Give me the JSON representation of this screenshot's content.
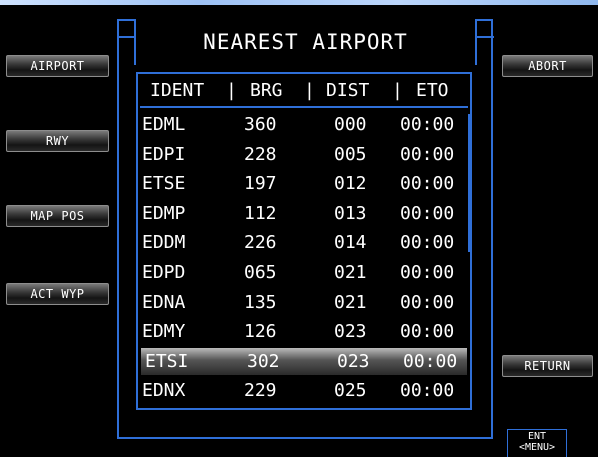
{
  "window": {
    "title": "NEAREST AIRPORT"
  },
  "left_buttons": [
    {
      "label": "AIRPORT"
    },
    {
      "label": "RWY"
    },
    {
      "label": "MAP POS"
    },
    {
      "label": "ACT WYP"
    }
  ],
  "right_buttons": [
    {
      "label": "ABORT"
    },
    {
      "label": "RETURN"
    }
  ],
  "table": {
    "headers": {
      "ident": "IDENT",
      "brg": "BRG",
      "dist": "DIST",
      "eto": "ETO",
      "sep": "|"
    },
    "selected_index": 8,
    "rows": [
      {
        "ident": "EDML",
        "brg": "360",
        "dist": "000",
        "eto": "00:00"
      },
      {
        "ident": "EDPI",
        "brg": "228",
        "dist": "005",
        "eto": "00:00"
      },
      {
        "ident": "ETSE",
        "brg": "197",
        "dist": "012",
        "eto": "00:00"
      },
      {
        "ident": "EDMP",
        "brg": "112",
        "dist": "013",
        "eto": "00:00"
      },
      {
        "ident": "EDDM",
        "brg": "226",
        "dist": "014",
        "eto": "00:00"
      },
      {
        "ident": "EDPD",
        "brg": "065",
        "dist": "021",
        "eto": "00:00"
      },
      {
        "ident": "EDNA",
        "brg": "135",
        "dist": "021",
        "eto": "00:00"
      },
      {
        "ident": "EDMY",
        "brg": "126",
        "dist": "023",
        "eto": "00:00"
      },
      {
        "ident": "ETSI",
        "brg": "302",
        "dist": "023",
        "eto": "00:00"
      },
      {
        "ident": "EDNX",
        "brg": "229",
        "dist": "025",
        "eto": "00:00"
      }
    ]
  },
  "ent": {
    "label": "ENT",
    "menu_label": "<MENU>"
  },
  "colors": {
    "frame": "#2f6fd8",
    "background": "#000000",
    "text": "#ffffff"
  }
}
